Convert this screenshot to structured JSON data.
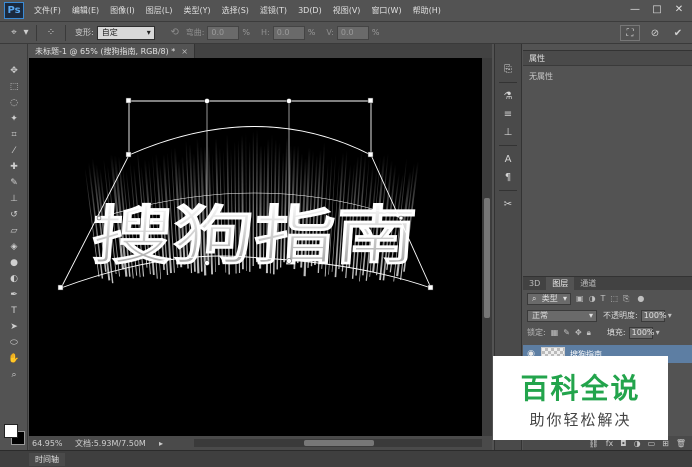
{
  "app": {
    "logo": "Ps"
  },
  "menu": [
    "文件(F)",
    "编辑(E)",
    "图像(I)",
    "图层(L)",
    "类型(Y)",
    "选择(S)",
    "滤镜(T)",
    "3D(D)",
    "视图(V)",
    "窗口(W)",
    "帮助(H)"
  ],
  "window_controls": [
    "—",
    "□",
    "✕"
  ],
  "options": {
    "warp_label": "变形:",
    "warp_value": "自定",
    "bend_label": "弯曲:",
    "bend_value": "0.0",
    "h_label": "H:",
    "h_value": "0.0",
    "v_label": "V:",
    "v_value": "0.0",
    "unit": "%"
  },
  "document": {
    "tab_title": "未标题-1 @ 65% (搜狗指南, RGB/8) *",
    "close": "×"
  },
  "status": {
    "zoom": "64.95%",
    "doc_info": "文档:5.93M/7.50M"
  },
  "timeline": {
    "label": "时间轴"
  },
  "properties": {
    "tab": "属性",
    "body": "无属性"
  },
  "layers": {
    "tabs": [
      "3D",
      "图层",
      "通道"
    ],
    "filter_label": "类型",
    "blend_mode": "正常",
    "opacity_label": "不透明度:",
    "opacity_value": "100%",
    "lock_label": "锁定:",
    "fill_label": "填充:",
    "fill_value": "100%",
    "layer_name": "搜狗指南"
  },
  "canvas_text": "搜狗指南",
  "watermark": {
    "title": "百科全说",
    "subtitle": "助你轻松解决"
  },
  "colors": {
    "accent": "#5d7ea3",
    "watermark_green": "#23a44c"
  }
}
